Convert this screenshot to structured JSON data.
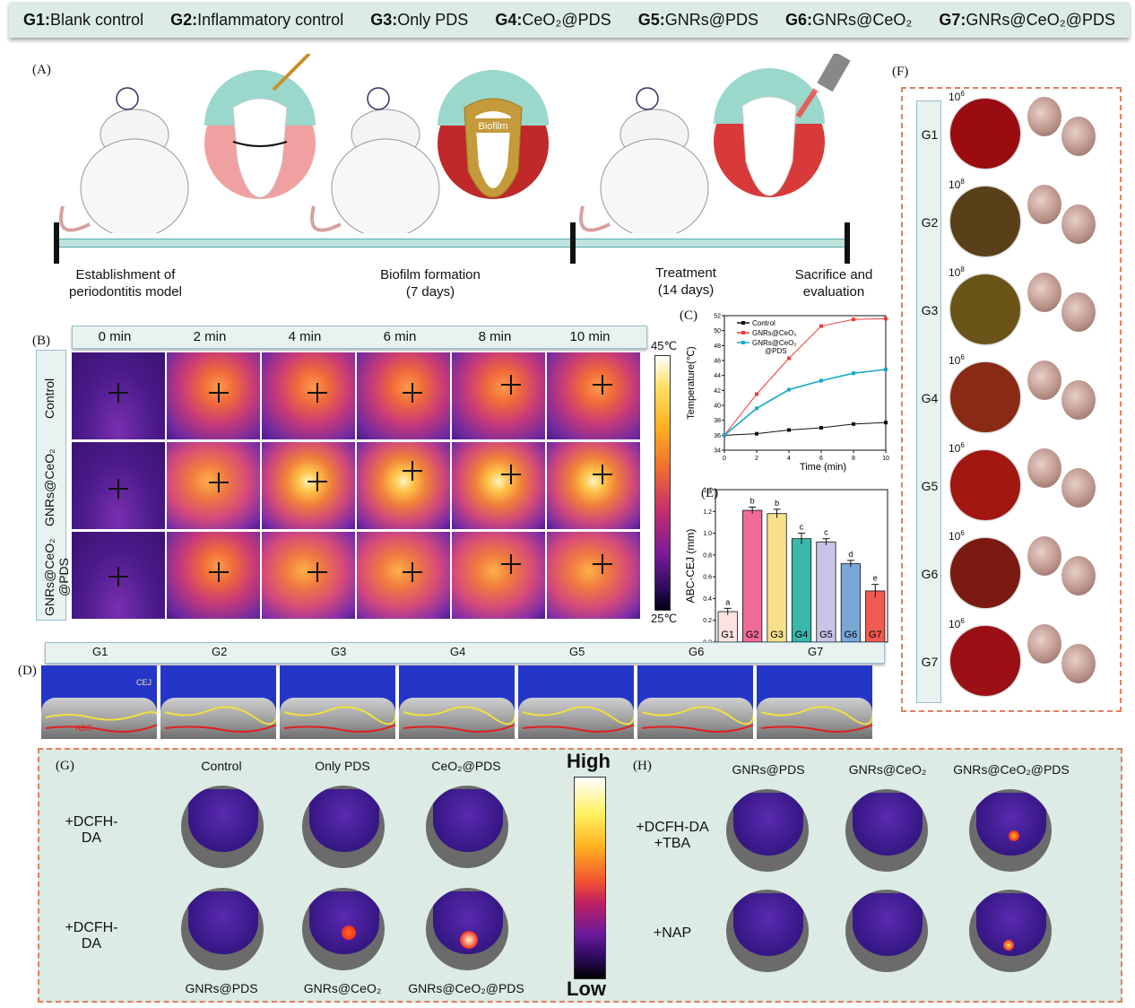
{
  "legend": {
    "groups": [
      {
        "code": "G1:",
        "name": "Blank control"
      },
      {
        "code": "G2:",
        "name": "Inflammatory control"
      },
      {
        "code": "G3:",
        "name": "Only PDS"
      },
      {
        "code": "G4:",
        "name": "CeO₂@PDS"
      },
      {
        "code": "G5:",
        "name": "GNRs@PDS"
      },
      {
        "code": "G6:",
        "name": "GNRs@CeO₂"
      },
      {
        "code": "G7:",
        "name": "GNRs@CeO₂@PDS"
      }
    ]
  },
  "panel_a": {
    "letter": "(A)",
    "biofilm_label": "Biofilm",
    "timeline": [
      "Establishment of\nperiodontitis model",
      "Biofilm formation\n(7 days)",
      "Treatment\n(14 days)",
      "Sacrifice and\nevaluation"
    ]
  },
  "panel_b": {
    "letter": "(B)",
    "times": [
      "0 min",
      "2 min",
      "4 min",
      "6 min",
      "8 min",
      "10 min"
    ],
    "rows": [
      "Control",
      "GNRs@CeO₂",
      "GNRs@CeO₂\n@PDS"
    ],
    "scale_top": "45℃",
    "scale_bottom": "25℃"
  },
  "panel_d": {
    "letter": "(D)",
    "groups": [
      "G1",
      "G2",
      "G3",
      "G4",
      "G5",
      "G6",
      "G7"
    ],
    "cej_label": "CEJ",
    "abc_label": "ABC"
  },
  "panel_f": {
    "letter": "(F)",
    "rows": [
      {
        "group": "G1",
        "count_base": "10",
        "count_exp": "6",
        "plate": "#9a0c10"
      },
      {
        "group": "G2",
        "count_base": "10",
        "count_exp": "8",
        "plate": "#5a4018"
      },
      {
        "group": "G3",
        "count_base": "10",
        "count_exp": "8",
        "plate": "#6a5418"
      },
      {
        "group": "G4",
        "count_base": "10",
        "count_exp": "6",
        "plate": "#8a2a14"
      },
      {
        "group": "G5",
        "count_base": "10",
        "count_exp": "6",
        "plate": "#a01810"
      },
      {
        "group": "G6",
        "count_base": "10",
        "count_exp": "6",
        "plate": "#7a1a10"
      },
      {
        "group": "G7",
        "count_base": "10",
        "count_exp": "6",
        "plate": "#9a1014"
      }
    ]
  },
  "panel_g": {
    "letter": "(G)",
    "top_labels": [
      "Control",
      "Only PDS",
      "CeO₂@PDS"
    ],
    "bottom_labels": [
      "GNRs@PDS",
      "GNRs@CeO₂",
      "GNRs@CeO₂@PDS"
    ],
    "row_labels": [
      "+DCFH-DA",
      "+DCFH-DA"
    ],
    "scale_high": "High",
    "scale_low": "Low"
  },
  "panel_h": {
    "letter": "(H)",
    "top_labels": [
      "GNRs@PDS",
      "GNRs@CeO₂",
      "GNRs@CeO₂@PDS"
    ],
    "row_labels": [
      "+DCFH-DA\n+TBA",
      "+NAP"
    ]
  },
  "chart_data": [
    {
      "panel": "(C)",
      "type": "line",
      "xlabel": "Time (min)",
      "ylabel": "Temperature(℃)",
      "xlim": [
        0,
        10
      ],
      "ylim": [
        34,
        52
      ],
      "xticks": [
        0,
        2,
        4,
        6,
        8,
        10
      ],
      "yticks": [
        34,
        36,
        38,
        40,
        42,
        44,
        46,
        48,
        50,
        52
      ],
      "x": [
        0,
        2,
        4,
        6,
        8,
        10
      ],
      "series": [
        {
          "name": "Control",
          "color": "#111111",
          "values": [
            36.0,
            36.2,
            36.7,
            37.0,
            37.5,
            37.7
          ]
        },
        {
          "name": "GNRs@CeO₂",
          "color": "#f03a3a",
          "values": [
            36.0,
            41.5,
            46.3,
            50.6,
            51.5,
            51.6
          ]
        },
        {
          "name": "GNRs@CeO₂\n@PDS",
          "color": "#1aa8c8",
          "values": [
            36.0,
            39.6,
            42.1,
            43.3,
            44.3,
            44.8
          ]
        }
      ],
      "legend_position": "top-left",
      "grid": false
    },
    {
      "panel": "(E)",
      "type": "bar",
      "ylabel": "ABC-CEJ (mm)",
      "ylim": [
        0,
        1.4
      ],
      "yticks": [
        0.0,
        0.2,
        0.4,
        0.6,
        0.8,
        1.0,
        1.2,
        1.4
      ],
      "categories": [
        "G1",
        "G2",
        "G3",
        "G4",
        "G5",
        "G6",
        "G7"
      ],
      "values": [
        0.28,
        1.21,
        1.18,
        0.95,
        0.92,
        0.72,
        0.47
      ],
      "errors": [
        0.03,
        0.03,
        0.04,
        0.05,
        0.03,
        0.03,
        0.06
      ],
      "significance": [
        "a",
        "b",
        "b",
        "c",
        "c",
        "d",
        "e"
      ],
      "colors": [
        "#fbe3e0",
        "#f06a96",
        "#f8e08a",
        "#3ab8ac",
        "#c9c3e6",
        "#7aa6d8",
        "#f05a50"
      ],
      "grid": false
    }
  ]
}
